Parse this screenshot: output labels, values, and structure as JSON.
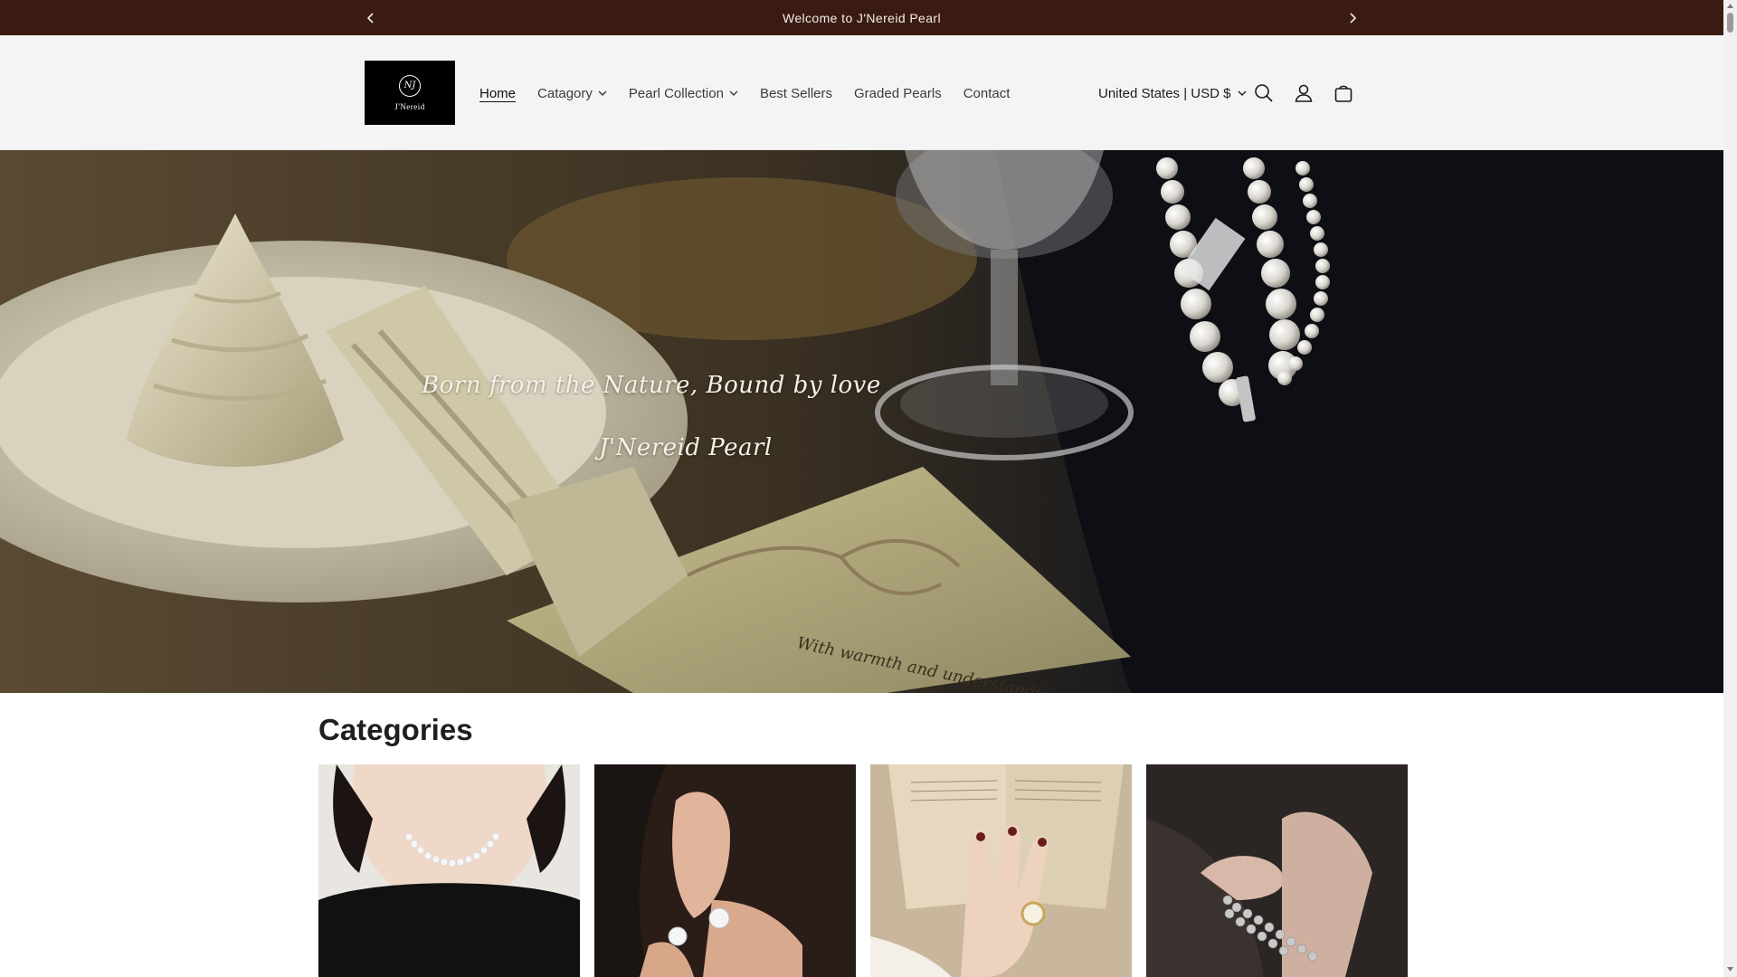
{
  "announcement": {
    "text": "Welcome to J'Nereid Pearl"
  },
  "header": {
    "logo_text": "J'Nereid",
    "logo_mark": "NJ",
    "nav": [
      {
        "label": "Home",
        "active": true,
        "dropdown": false
      },
      {
        "label": "Catagory",
        "active": false,
        "dropdown": true
      },
      {
        "label": "Pearl Collection",
        "active": false,
        "dropdown": true
      },
      {
        "label": "Best Sellers",
        "active": false,
        "dropdown": false
      },
      {
        "label": "Graded Pearls",
        "active": false,
        "dropdown": false
      },
      {
        "label": "Contact",
        "active": false,
        "dropdown": false
      }
    ],
    "country_selector": "United States | USD $",
    "icons": [
      "search-icon",
      "account-icon",
      "cart-icon"
    ]
  },
  "hero": {
    "line1": "Born from the Nature, Bound  by love",
    "line2": "J'Nereid Pearl",
    "card_text": "With warmth and understanding at this time of"
  },
  "categories": {
    "title": "Categories",
    "items": [
      {
        "image": "pearl-necklace-photo"
      },
      {
        "image": "pearl-earrings-photo"
      },
      {
        "image": "pearl-ring-photo"
      },
      {
        "image": "pearl-bracelet-photo"
      }
    ]
  },
  "colors": {
    "announcement_bg": "#3a1b12",
    "header_bg": "#f4f4f4",
    "text": "#1a1a1a"
  }
}
